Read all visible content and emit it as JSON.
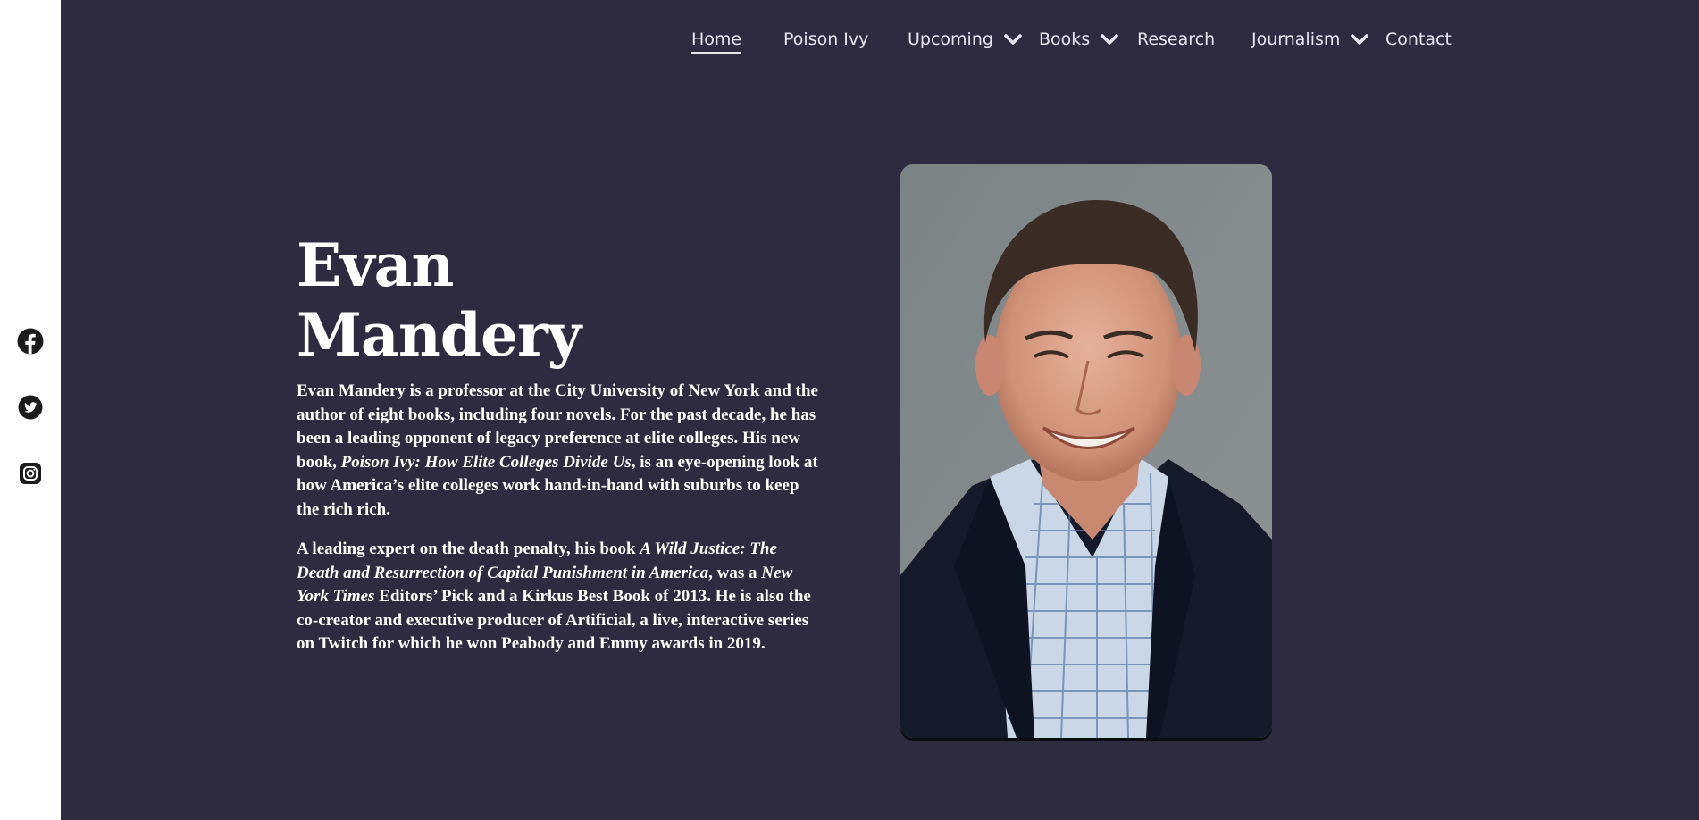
{
  "nav": {
    "items": [
      {
        "label": "Home",
        "active": true,
        "has_dropdown": false
      },
      {
        "label": "Poison Ivy",
        "active": false,
        "has_dropdown": false
      },
      {
        "label": "Upcoming",
        "active": false,
        "has_dropdown": true
      },
      {
        "label": "Books",
        "active": false,
        "has_dropdown": true
      },
      {
        "label": "Research",
        "active": false,
        "has_dropdown": false
      },
      {
        "label": "Journalism",
        "active": false,
        "has_dropdown": true
      },
      {
        "label": "Contact",
        "active": false,
        "has_dropdown": false
      }
    ]
  },
  "social": {
    "icons": [
      "facebook-icon",
      "twitter-icon",
      "instagram-icon"
    ]
  },
  "hero": {
    "name_line1": "Evan",
    "name_line2": "Mandery",
    "bio1": {
      "a": "Evan Mandery is a professor at the City University of New York and the author of eight books, including four novels. For the past decade, he has been a leading opponent of legacy preference at elite colleges. His new book, ",
      "b": "Poison Ivy: How Elite Colleges Divide Us",
      "c": ", is an eye-opening look at how America’s elite colleges work hand-in-hand with suburbs to keep the rich rich."
    },
    "bio2": {
      "a": "A leading expert on the death penalty, his book ",
      "b": "A Wild Justice: The Death and Resurrection of Capital Punishment in America",
      "c": ", was a ",
      "d": "New York Times",
      "e": " Editors’ Pick and a Kirkus Best Book of 2013. He is also the co-creator and executive producer of Artificial, a live, interactive series on Twitch for which he won Peabody and Emmy awards in 2019."
    }
  },
  "colors": {
    "background": "#2e2b40",
    "sidebar": "#ffffff",
    "text": "#ffffff",
    "nav_text": "#e7e6f0"
  }
}
